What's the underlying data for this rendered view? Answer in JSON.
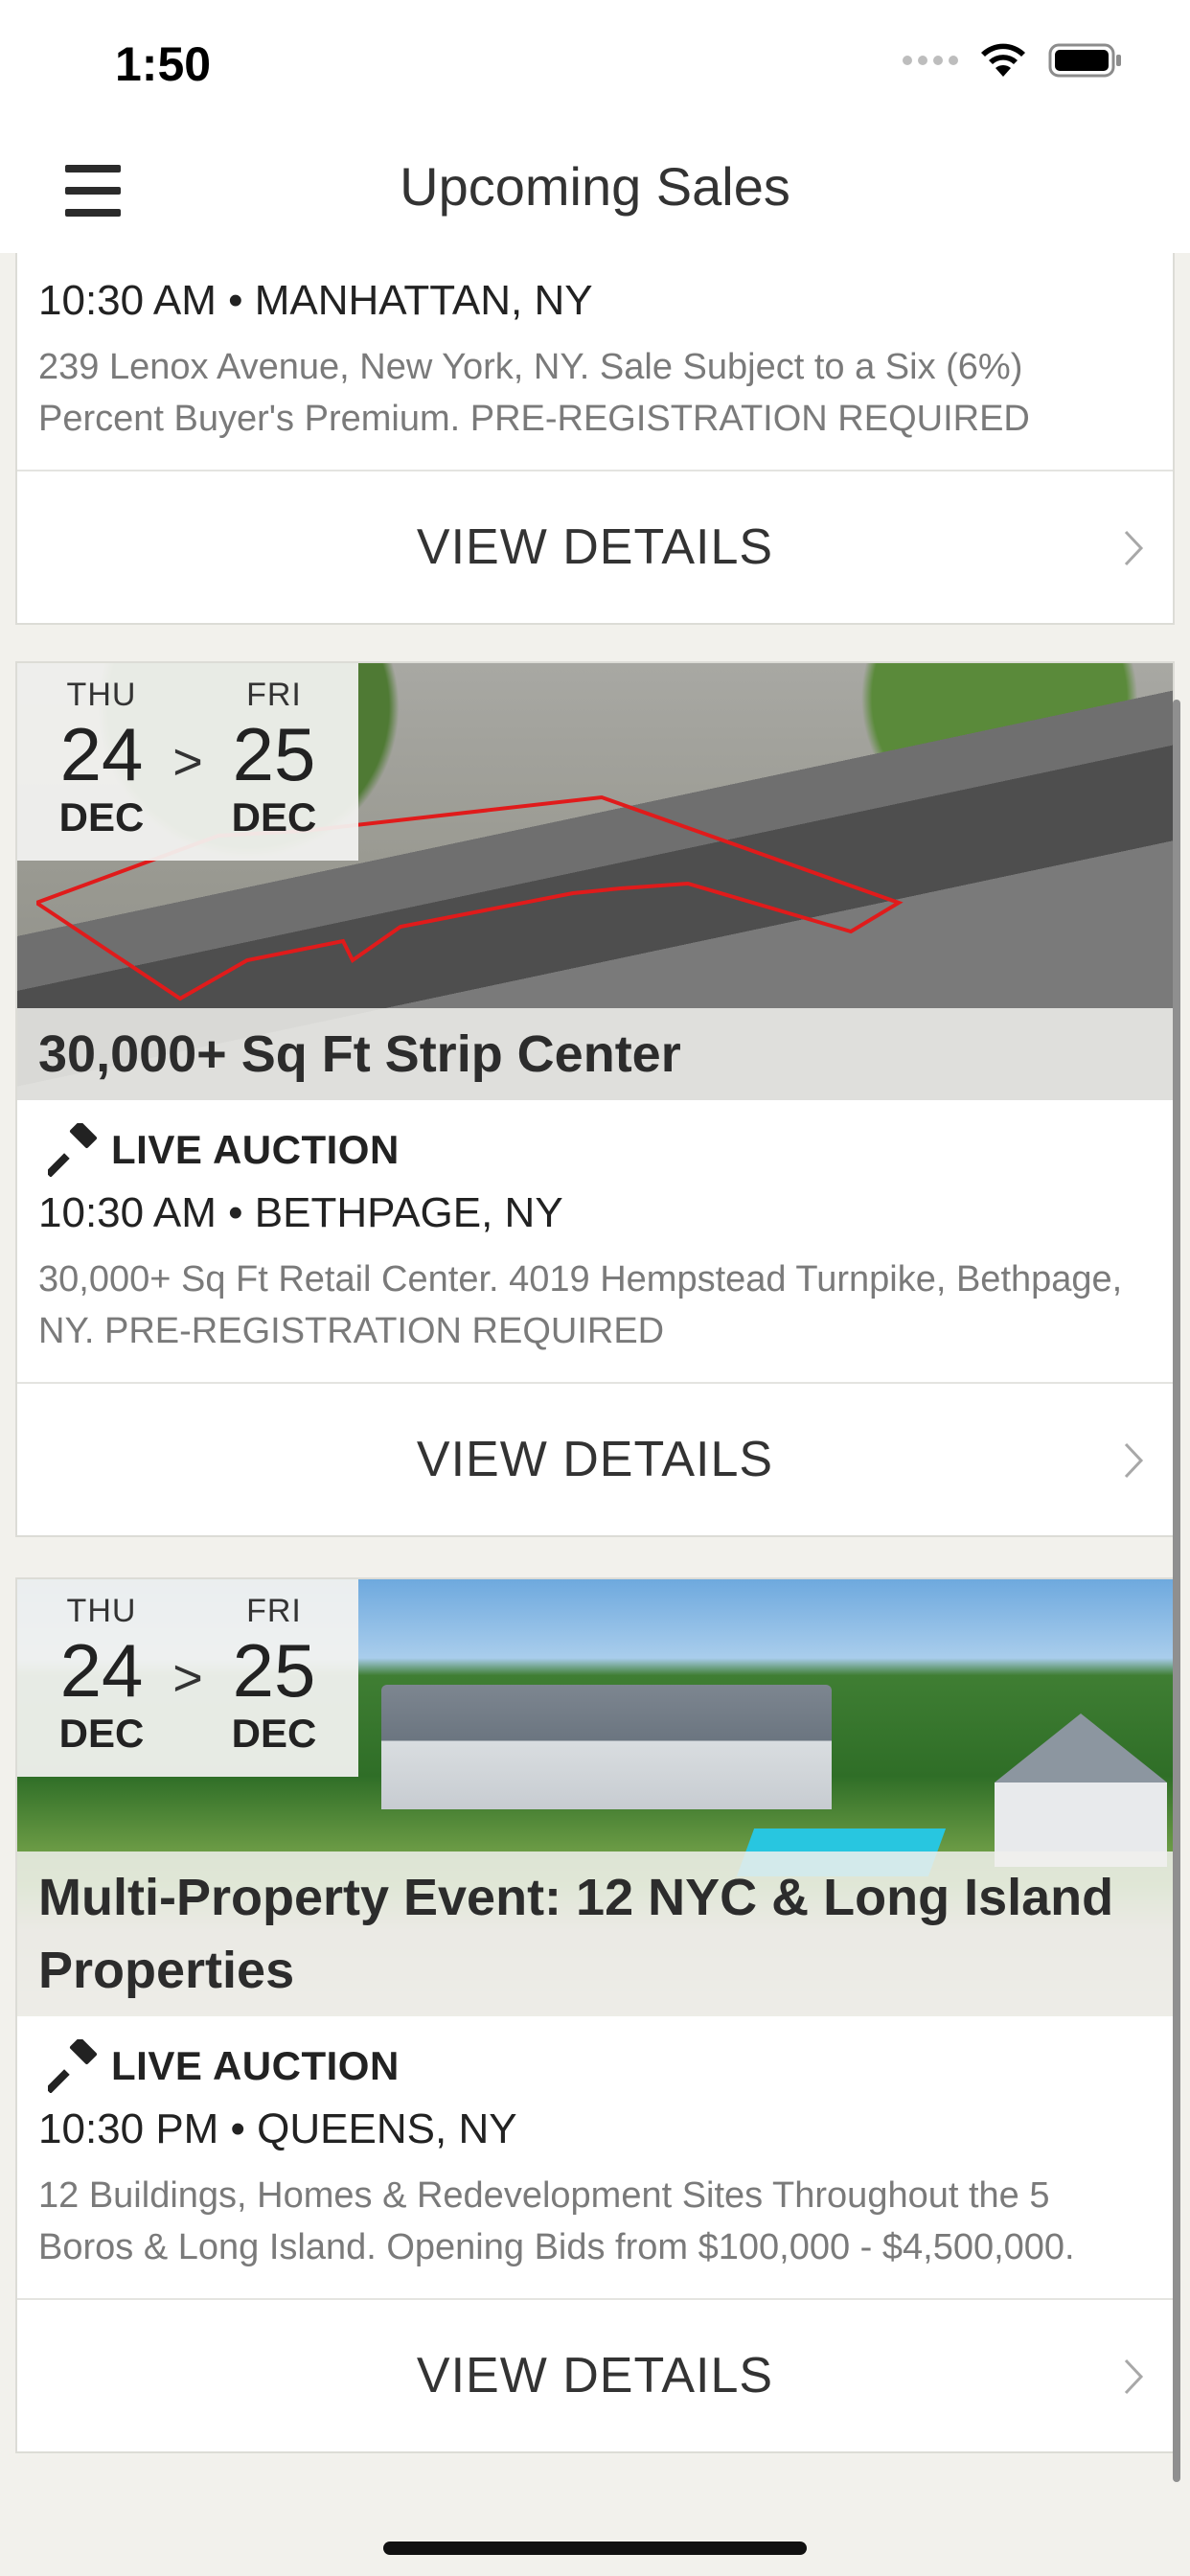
{
  "status_bar": {
    "time": "1:50"
  },
  "nav": {
    "title": "Upcoming Sales"
  },
  "sales": [
    {
      "time_location": "10:30 AM • MANHATTAN, NY",
      "description": "239 Lenox Avenue, New York, NY. Sale Subject to a Six (6%) Percent Buyer's Premium. PRE-REGISTRATION REQUIRED",
      "details_label": "VIEW DETAILS"
    },
    {
      "start": {
        "dow": "THU",
        "day": "24",
        "month": "DEC"
      },
      "end": {
        "dow": "FRI",
        "day": "25",
        "month": "DEC"
      },
      "separator": ">",
      "title": "30,000+ Sq Ft Strip Center",
      "auction_type": "LIVE AUCTION",
      "time_location": "10:30 AM • BETHPAGE, NY",
      "description": "30,000+ Sq Ft Retail Center. 4019 Hempstead Turnpike, Bethpage, NY. PRE-REGISTRATION REQUIRED",
      "details_label": "VIEW DETAILS"
    },
    {
      "start": {
        "dow": "THU",
        "day": "24",
        "month": "DEC"
      },
      "end": {
        "dow": "FRI",
        "day": "25",
        "month": "DEC"
      },
      "separator": ">",
      "title": "Multi-Property Event: 12 NYC & Long Island Properties",
      "auction_type": "LIVE AUCTION",
      "time_location": "10:30 PM • QUEENS, NY",
      "description": "12 Buildings, Homes & Redevelopment Sites Throughout the 5 Boros & Long Island. Opening Bids from $100,000 - $4,500,000.",
      "details_label": "VIEW DETAILS"
    }
  ]
}
